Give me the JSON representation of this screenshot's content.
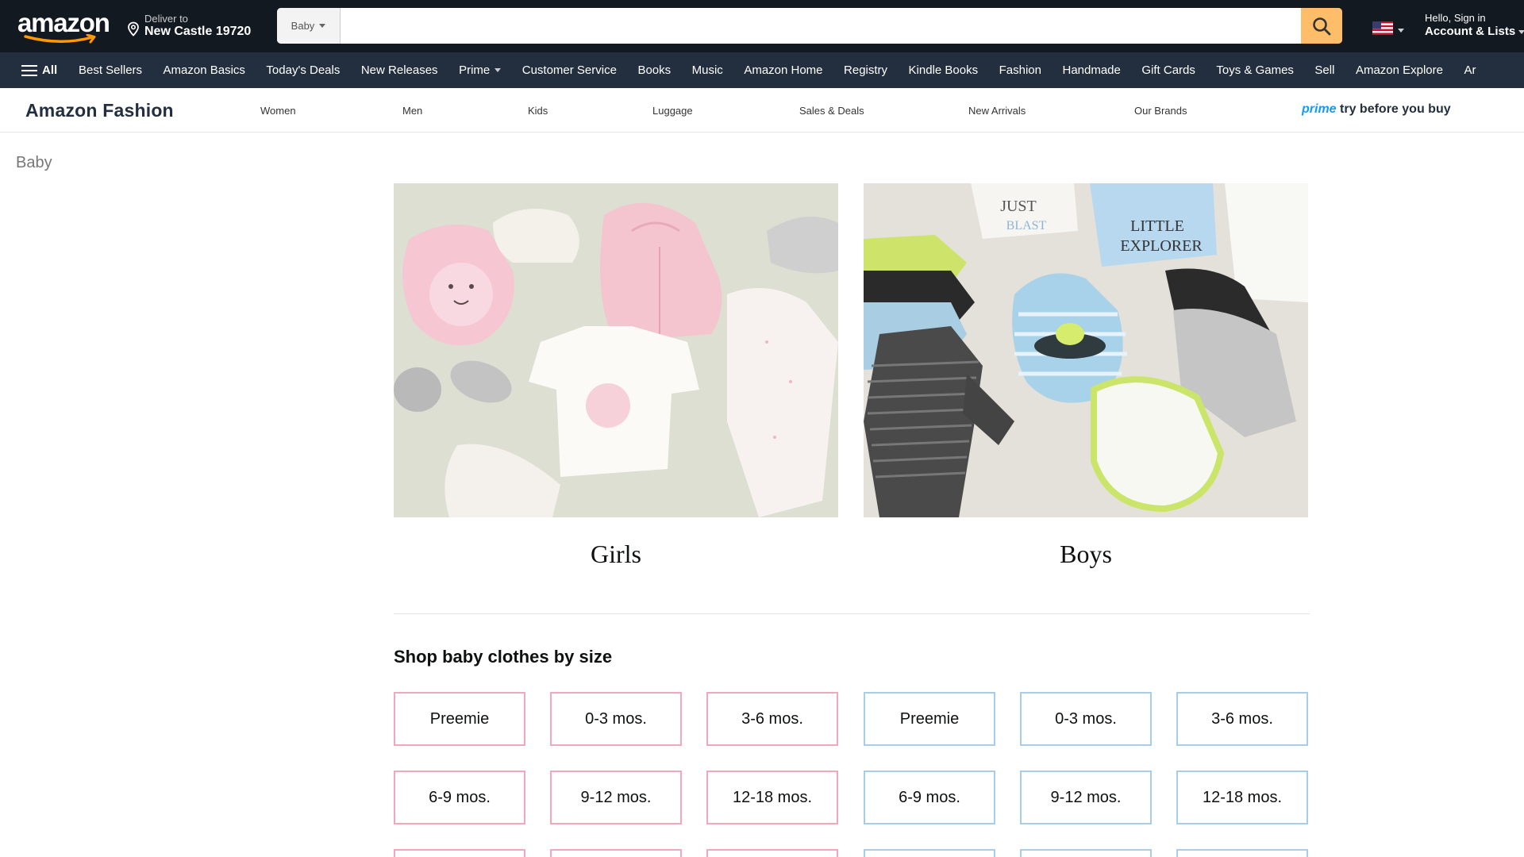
{
  "header": {
    "logo_text": "amazon",
    "deliver_line1": "Deliver to",
    "deliver_line2": "New Castle 19720",
    "search_department": "Baby",
    "search_value": "",
    "account_line1": "Hello, Sign in",
    "account_line2": "Account & Lists"
  },
  "nav": {
    "all_label": "All",
    "items": [
      {
        "label": "Best Sellers"
      },
      {
        "label": "Amazon Basics"
      },
      {
        "label": "Today's Deals"
      },
      {
        "label": "New Releases"
      },
      {
        "label": "Prime"
      },
      {
        "label": "Customer Service"
      },
      {
        "label": "Books"
      },
      {
        "label": "Music"
      },
      {
        "label": "Amazon Home"
      },
      {
        "label": "Registry"
      },
      {
        "label": "Kindle Books"
      },
      {
        "label": "Fashion"
      },
      {
        "label": "Handmade"
      },
      {
        "label": "Gift Cards"
      },
      {
        "label": "Toys & Games"
      },
      {
        "label": "Sell"
      },
      {
        "label": "Amazon Explore"
      },
      {
        "label": "Ar"
      }
    ]
  },
  "subnav": {
    "brand": "Amazon Fashion",
    "links": [
      "Women",
      "Men",
      "Kids",
      "Luggage",
      "Sales & Deals",
      "New Arrivals",
      "Our Brands"
    ],
    "prime_word": "prime",
    "try_text": "try before you buy"
  },
  "breadcrumb": "Baby",
  "categories": [
    {
      "label": "Girls"
    },
    {
      "label": "Boys"
    }
  ],
  "sizes": {
    "title": "Shop baby clothes by size",
    "row1": [
      "Preemie",
      "0-3 mos.",
      "3-6 mos.",
      "Preemie",
      "0-3 mos.",
      "3-6 mos."
    ],
    "row2": [
      "6-9 mos.",
      "9-12 mos.",
      "12-18 mos.",
      "6-9 mos.",
      "9-12 mos.",
      "12-18 mos."
    ]
  },
  "colors": {
    "topbar": "#131921",
    "navbar": "#232f3e",
    "search_button": "#febd69",
    "girl_border": "#f2a7bd",
    "boy_border": "#a7cdea",
    "prime_blue": "#1399ff"
  }
}
